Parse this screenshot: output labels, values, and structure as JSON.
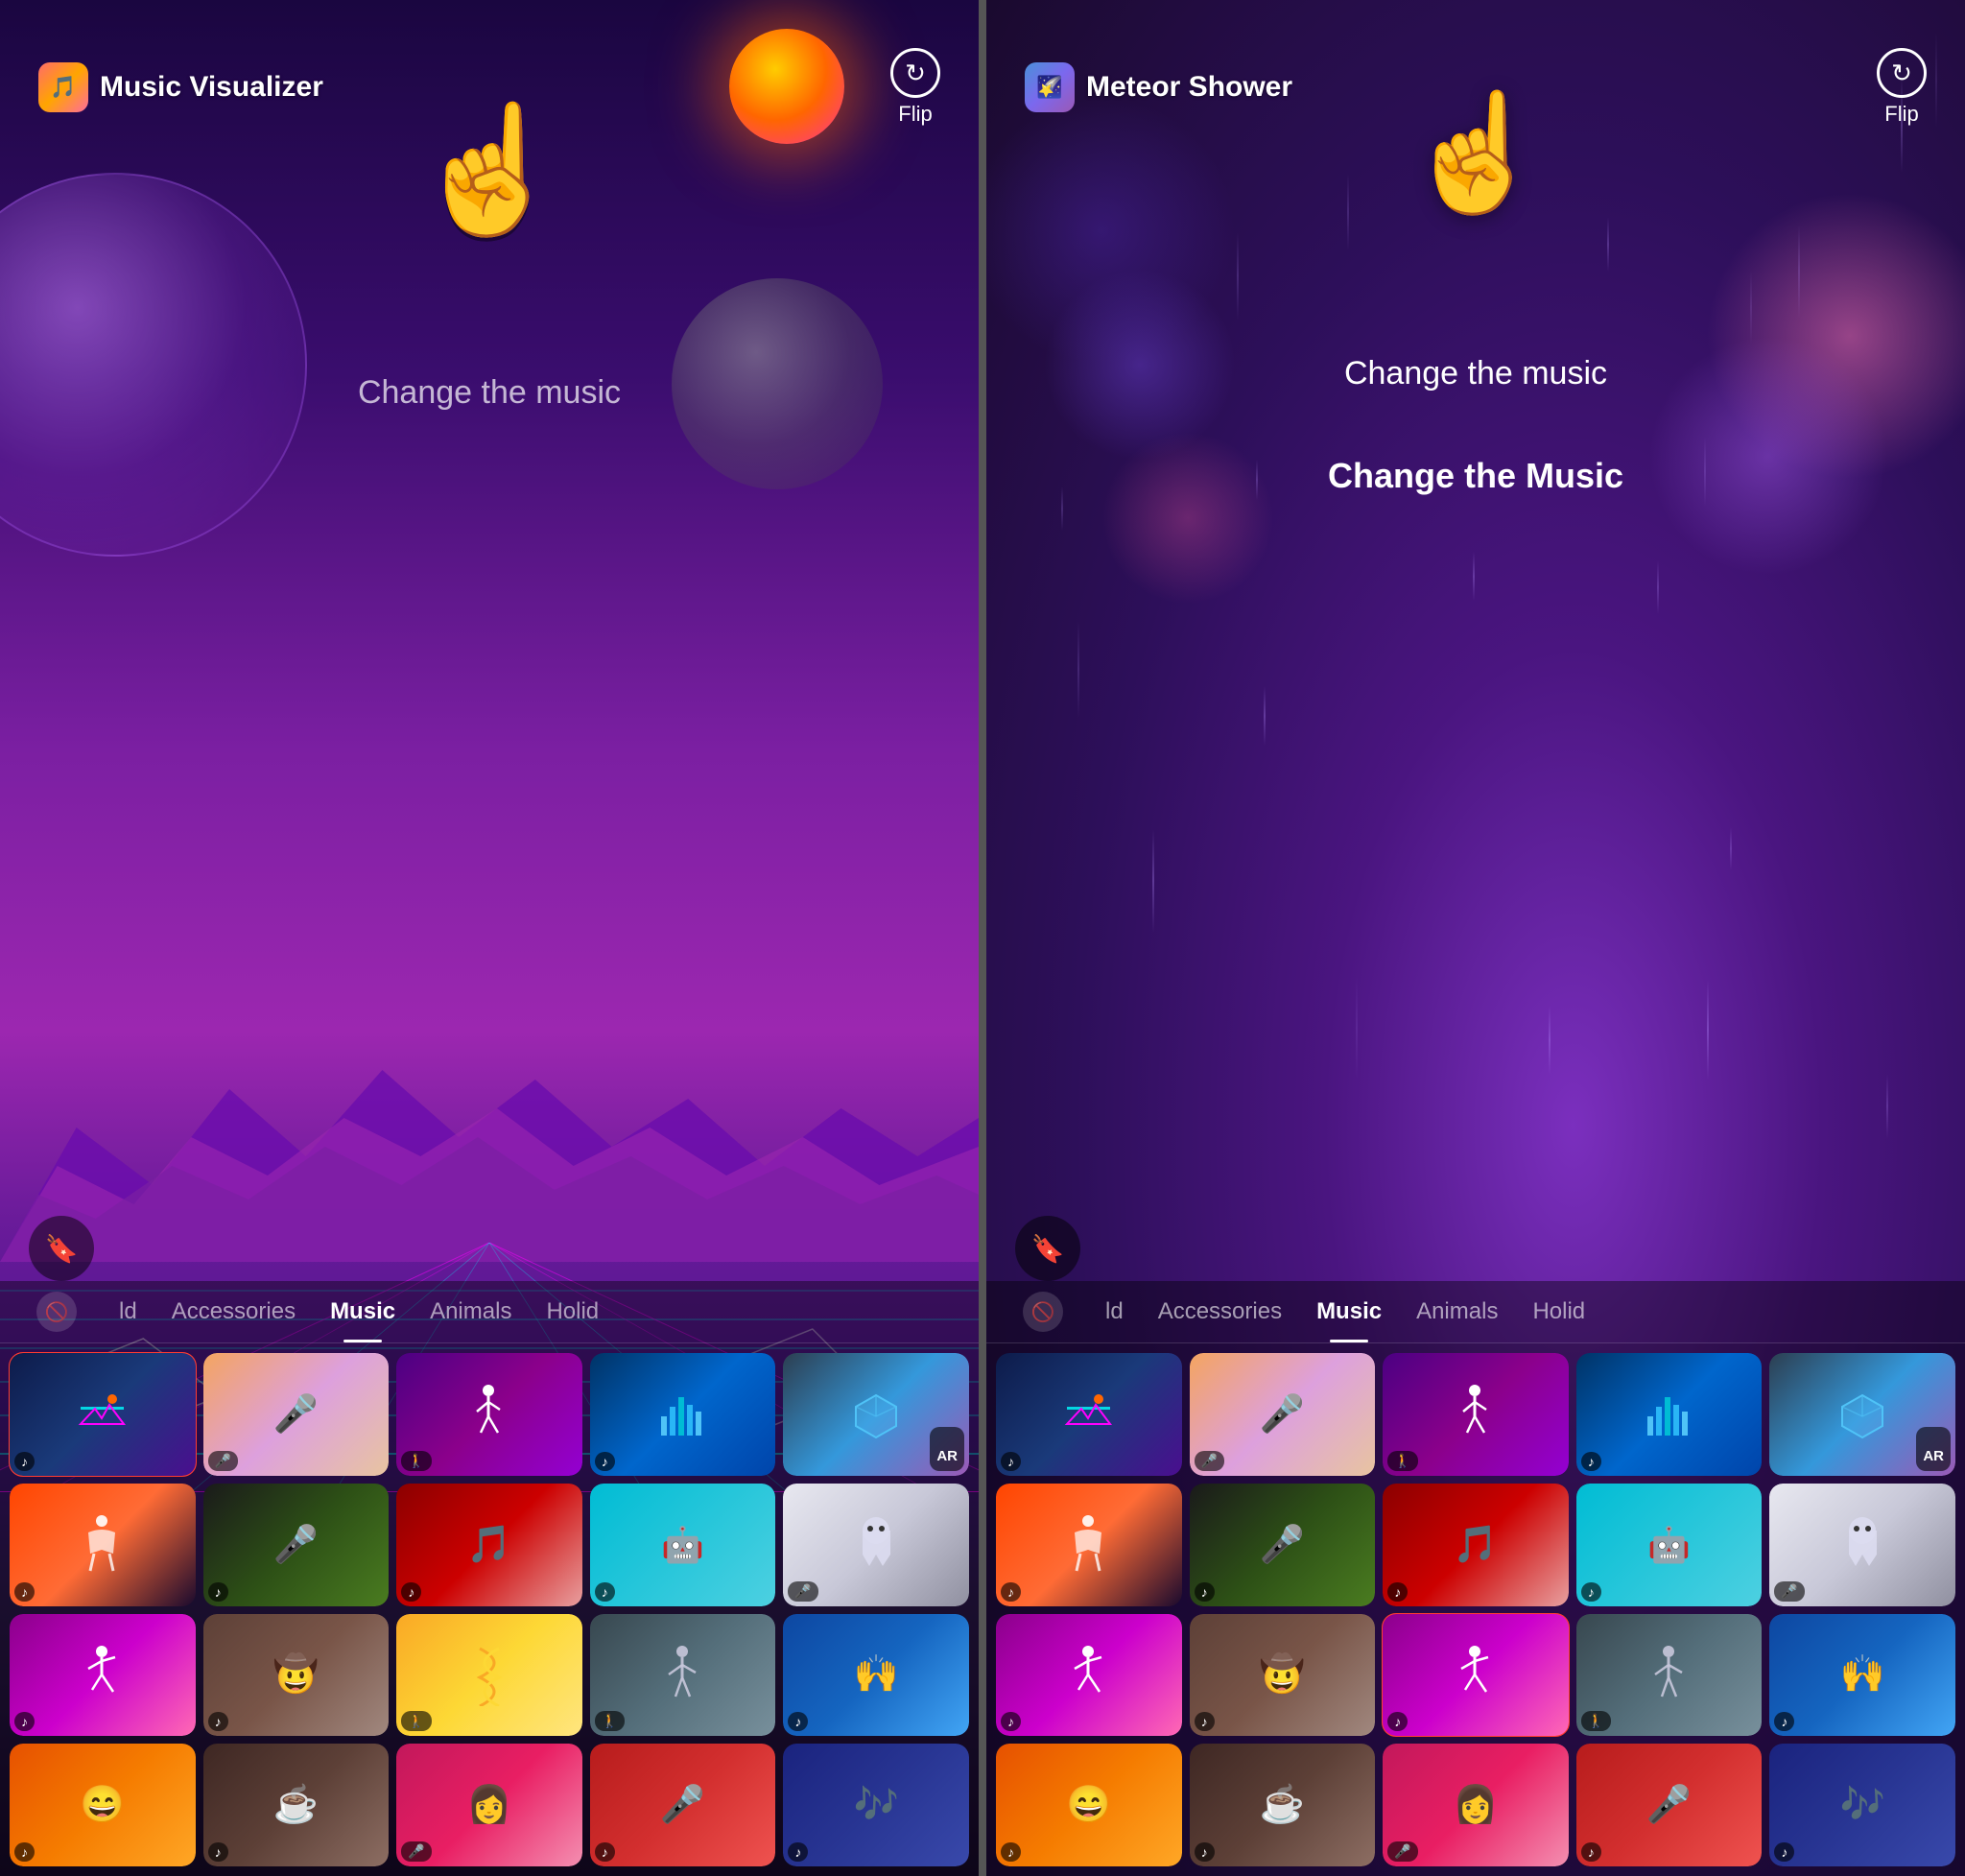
{
  "panels": [
    {
      "id": "left",
      "header": {
        "app_title": "Music Visualizer",
        "app_icon": "🎵",
        "flip_label": "Flip"
      },
      "change_music": "Change the music",
      "change_music_bold": null,
      "tabs": [
        {
          "id": "no-filter",
          "label": "",
          "icon": "🚫",
          "active": false
        },
        {
          "id": "world",
          "label": "ld",
          "active": false
        },
        {
          "id": "accessories",
          "label": "Accessories",
          "active": false
        },
        {
          "id": "music",
          "label": "Music",
          "active": true
        },
        {
          "id": "animals",
          "label": "Animals",
          "active": false
        },
        {
          "id": "holidays",
          "label": "Holid",
          "active": false
        }
      ],
      "selected_filter": 0,
      "filters": [
        {
          "id": "synthwave",
          "class": "ft-synthwave",
          "badge": "🎵",
          "badge_type": "music",
          "selected": true
        },
        {
          "id": "vocal",
          "class": "ft-vocal",
          "badge": "🎤",
          "badge_type": "mic",
          "selected": false
        },
        {
          "id": "dance",
          "class": "ft-dance",
          "badge": "🚶",
          "badge_type": "walk",
          "selected": false
        },
        {
          "id": "beats",
          "class": "ft-beats",
          "badge": "🎵",
          "badge_type": "music",
          "selected": false
        },
        {
          "id": "cube",
          "class": "ft-cube",
          "badge": "AR",
          "badge_type": "ar",
          "selected": false
        },
        {
          "id": "silhouette",
          "class": "ft-silhouette",
          "badge": "🎵",
          "badge_type": "music",
          "selected": false
        },
        {
          "id": "colormic",
          "class": "ft-colormic",
          "badge": "🎵",
          "badge_type": "music",
          "selected": false
        },
        {
          "id": "musicnote",
          "class": "ft-musicnote",
          "badge": "🎵",
          "badge_type": "music",
          "selected": false
        },
        {
          "id": "robot",
          "class": "ft-robot",
          "badge": "🎵",
          "badge_type": "music",
          "selected": false
        },
        {
          "id": "ghost",
          "class": "ft-ghost",
          "badge": "🎤",
          "badge_type": "mic",
          "selected": false
        },
        {
          "id": "dancing2",
          "class": "ft-dancing2",
          "badge": "🎵",
          "badge_type": "music",
          "selected": false
        },
        {
          "id": "cowboy",
          "class": "ft-cowboy",
          "badge": "🎵",
          "badge_type": "music",
          "selected": false
        },
        {
          "id": "dna",
          "class": "ft-dna",
          "badge": "🚶",
          "badge_type": "walk",
          "selected": false
        },
        {
          "id": "dancer3",
          "class": "ft-dancer3",
          "badge": "🚶",
          "badge_type": "walk",
          "selected": false
        },
        {
          "id": "concert",
          "class": "ft-concert",
          "badge": "🎵",
          "badge_type": "music",
          "selected": false
        },
        {
          "id": "emojis",
          "class": "ft-emojis",
          "badge": "🎵",
          "badge_type": "music",
          "selected": false
        },
        {
          "id": "coffee",
          "class": "ft-coffee",
          "badge": "🎵",
          "badge_type": "music",
          "selected": false
        },
        {
          "id": "pinkgirl",
          "class": "ft-pinkgirl",
          "badge": "🎤",
          "badge_type": "mic",
          "selected": false
        },
        {
          "id": "reggaeton",
          "class": "ft-reggaeton",
          "badge": "🎵",
          "badge_type": "music",
          "selected": false
        },
        {
          "id": "mystery",
          "class": "ft-mystery",
          "badge": "🎵",
          "badge_type": "music",
          "selected": false
        }
      ]
    },
    {
      "id": "right",
      "header": {
        "app_title": "Meteor Shower",
        "app_icon": "⭐",
        "flip_label": "Flip"
      },
      "change_music": "Change the music",
      "change_music_bold": "Change the Music",
      "tabs": [
        {
          "id": "no-filter",
          "label": "",
          "icon": "🚫",
          "active": false
        },
        {
          "id": "world",
          "label": "ld",
          "active": false
        },
        {
          "id": "accessories",
          "label": "Accessories",
          "active": false
        },
        {
          "id": "music",
          "label": "Music",
          "active": true
        },
        {
          "id": "animals",
          "label": "Animals",
          "active": false
        },
        {
          "id": "holidays",
          "label": "Holid",
          "active": false
        }
      ],
      "selected_filter": 12,
      "filters": [
        {
          "id": "synthwave",
          "class": "ft-synthwave",
          "badge": "🎵",
          "badge_type": "music",
          "selected": false
        },
        {
          "id": "vocal",
          "class": "ft-vocal",
          "badge": "🎤",
          "badge_type": "mic",
          "selected": false
        },
        {
          "id": "dance",
          "class": "ft-dance",
          "badge": "🚶",
          "badge_type": "walk",
          "selected": false
        },
        {
          "id": "beats",
          "class": "ft-beats",
          "badge": "🎵",
          "badge_type": "music",
          "selected": false
        },
        {
          "id": "cube",
          "class": "ft-cube",
          "badge": "AR",
          "badge_type": "ar",
          "selected": false
        },
        {
          "id": "silhouette",
          "class": "ft-silhouette",
          "badge": "🎵",
          "badge_type": "music",
          "selected": false
        },
        {
          "id": "colormic",
          "class": "ft-colormic",
          "badge": "🎵",
          "badge_type": "music",
          "selected": false
        },
        {
          "id": "musicnote",
          "class": "ft-musicnote",
          "badge": "🎵",
          "badge_type": "music",
          "selected": false
        },
        {
          "id": "robot",
          "class": "ft-robot",
          "badge": "🎵",
          "badge_type": "music",
          "selected": false
        },
        {
          "id": "ghost",
          "class": "ft-ghost",
          "badge": "🎤",
          "badge_type": "mic",
          "selected": false
        },
        {
          "id": "dancing2",
          "class": "ft-dancing2",
          "badge": "🎵",
          "badge_type": "music",
          "selected": false
        },
        {
          "id": "cowboy",
          "class": "ft-cowboy",
          "badge": "🎵",
          "badge_type": "music",
          "selected": false
        },
        {
          "id": "meteor",
          "class": "ft-dancing2",
          "badge": "🎵",
          "badge_type": "music",
          "selected": true
        },
        {
          "id": "dancer3",
          "class": "ft-dancer3",
          "badge": "🚶",
          "badge_type": "walk",
          "selected": false
        },
        {
          "id": "concert",
          "class": "ft-concert",
          "badge": "🎵",
          "badge_type": "music",
          "selected": false
        },
        {
          "id": "emojis",
          "class": "ft-emojis",
          "badge": "🎵",
          "badge_type": "music",
          "selected": false
        },
        {
          "id": "coffee",
          "class": "ft-coffee",
          "badge": "🎵",
          "badge_type": "music",
          "selected": false
        },
        {
          "id": "pinkgirl",
          "class": "ft-pinkgirl",
          "badge": "🎤",
          "badge_type": "mic",
          "selected": false
        },
        {
          "id": "reggaeton",
          "class": "ft-reggaeton",
          "badge": "🎵",
          "badge_type": "music",
          "selected": false
        },
        {
          "id": "mystery",
          "class": "ft-mystery",
          "badge": "🎵",
          "badge_type": "music",
          "selected": false
        }
      ]
    }
  ]
}
